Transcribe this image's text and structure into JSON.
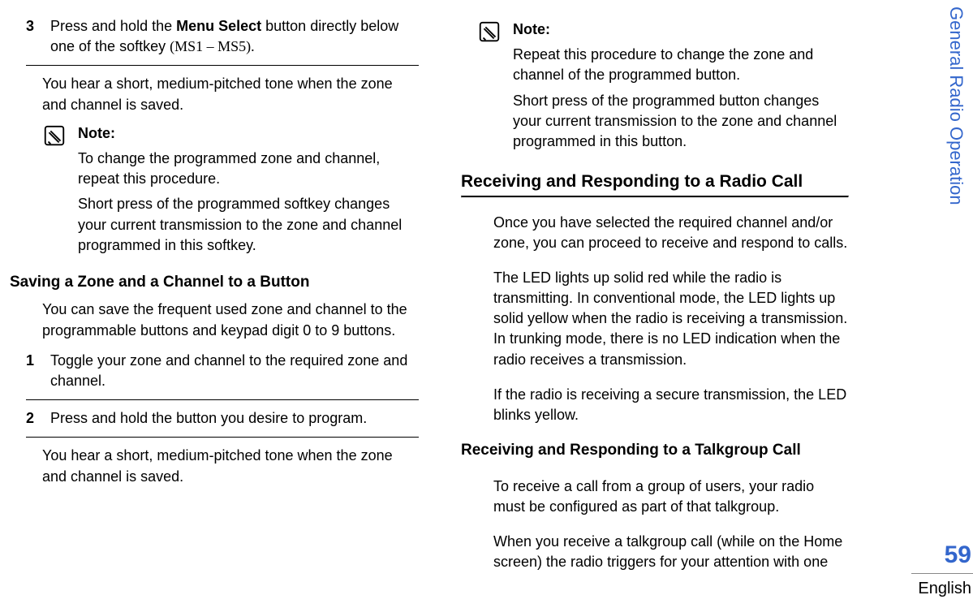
{
  "sidebar_label": "General Radio Operation",
  "page_number": "59",
  "language": "English",
  "col1": {
    "step3_num": "3",
    "step3_text_a": "Press and hold the ",
    "step3_bold": "Menu Select",
    "step3_text_b": " button directly below one of the softkey ",
    "step3_serif": "(MS1 – MS5).",
    "result1": "You hear a short, medium-pitched tone when the zone and channel is saved.",
    "note1_title": "Note:",
    "note1_p1": "To change the programmed zone and channel, repeat this procedure.",
    "note1_p2": "Short press of the programmed softkey changes your current transmission to the zone and channel programmed in this softkey.",
    "heading_sub": "Saving a Zone and a Channel to a Button",
    "intro1": "You can save the frequent used zone and channel to the programmable buttons and keypad digit 0 to 9 buttons.",
    "step1_num": "1",
    "step1_text": "Toggle your zone and channel to the required zone and channel.",
    "step2_num": "2",
    "step2_text": "Press and hold the button you desire to program.",
    "result2": "You hear a short, medium-pitched tone when the zone and channel is saved."
  },
  "col2": {
    "note2_title": "Note:",
    "note2_p1": "Repeat this procedure to change the zone and channel of the programmed button.",
    "note2_p2": "Short press of the programmed button changes your current transmission to the zone and channel programmed in this button.",
    "heading_main": "Receiving and Responding to a Radio Call",
    "p1": "Once you have selected the required channel and/or zone, you can proceed to receive and respond to calls.",
    "p2": "The LED lights up solid red while the radio is transmitting. In conventional mode, the LED lights up solid yellow when the radio is receiving a transmission. In trunking mode, there is no LED indication when the radio receives a transmission.",
    "p3": "If the radio is receiving a secure transmission, the LED blinks yellow.",
    "heading_sub2": "Receiving and Responding to a Talkgroup Call",
    "p4": "To receive a call from a group of users, your radio must be configured as part of that talkgroup.",
    "p5": "When you receive a talkgroup call (while on the Home screen) the radio triggers for your attention with one"
  }
}
